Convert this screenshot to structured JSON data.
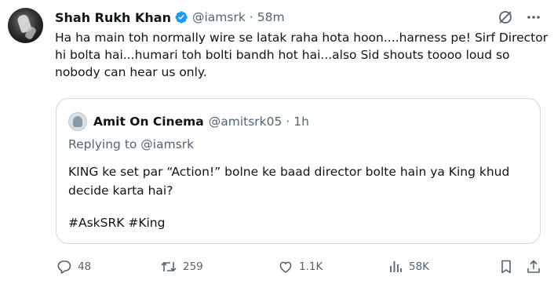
{
  "post": {
    "author_name": "Shah Rukh Khan",
    "handle": "@iamsrk",
    "separator": "·",
    "time": "58m",
    "text": "Ha ha main toh normally wire se latak raha hota hoon....harness pe! Sirf Director hi bolta hai...humari toh bolti bandh hot hai...also Sid shouts toooo loud so nobody can hear us only."
  },
  "quote": {
    "author_name": "Amit On Cinema",
    "handle": "@amitsrk05",
    "separator": "·",
    "time": "1h",
    "replying_to": "Replying to @iamsrk",
    "text": "KING ke set par “Action!” bolne ke baad director bolte hain ya King khud decide karta hai?",
    "hashtags": "#AskSRK #King"
  },
  "actions": {
    "replies": "48",
    "reposts": "259",
    "likes": "1.1K",
    "views": "58K"
  },
  "colors": {
    "text": "#0f1419",
    "secondary": "#536471",
    "verified": "#1d9bf0",
    "border": "#cfd9de"
  },
  "icons": [
    "verified-badge-icon",
    "grok-icon",
    "more-icon",
    "reply-icon",
    "repost-icon",
    "like-icon",
    "views-icon",
    "bookmark-icon",
    "share-icon"
  ]
}
